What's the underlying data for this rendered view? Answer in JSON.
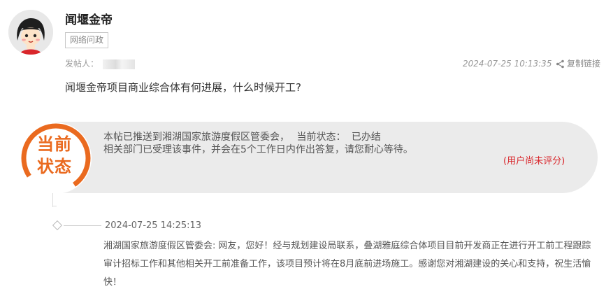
{
  "post": {
    "title": "闻堰金帝",
    "category": "网络问政",
    "poster_label": "发帖人：",
    "time": "2024-07-25 10:13:35",
    "copy_link_label": "复制链接",
    "question": "闻堰金帝项目商业综合体有何进展，什么时候开工?"
  },
  "status": {
    "badge_line1": "当前",
    "badge_line2": "状态",
    "forwarded_text": "本帖已推送到湘湖国家旅游度假区管委会，",
    "status_label": "当前状态：",
    "status_value": "已办结",
    "accepted_text": "相关部门已受理该事件，并会在5个工作日内作出答复，请您耐心等待。",
    "rating_text": "(用户尚未评分)",
    "accent_color": "#ea6a1f",
    "rating_color": "#d9262b"
  },
  "reply": {
    "time": "2024-07-25 14:25:13",
    "department": "湘湖国家旅游度假区管委会:",
    "content": "网友，您好！经与规划建设局联系，叠湖雅庭综合体项目目前开发商正在进行开工前工程跟踪审计招标工作和其他相关开工前准备工作，该项目预计将在8月底前进场施工。感谢您对湘湖建设的关心和支持，祝生活愉快！"
  },
  "icons": {
    "avatar": "cartoon-avatar-icon",
    "share": "share-icon",
    "timeline": "diamond-icon"
  }
}
